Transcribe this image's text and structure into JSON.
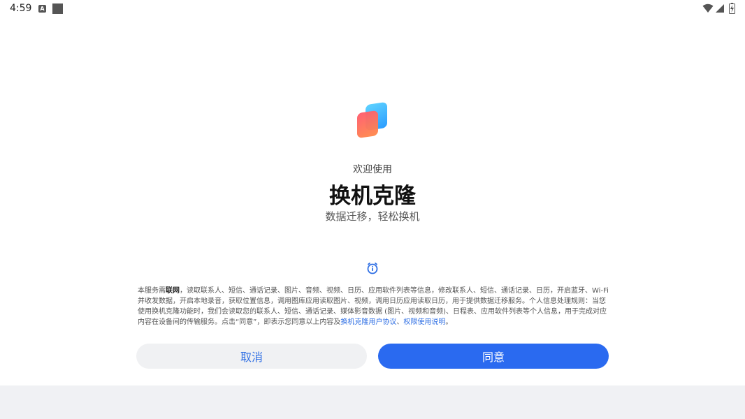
{
  "status_bar": {
    "time": "4:59",
    "a_icon_letter": "A"
  },
  "app": {
    "welcome": "欢迎使用",
    "title": "换机克隆",
    "subtitle": "数据迁移，轻松换机"
  },
  "privacy": {
    "p1": "本服务需",
    "bold": "联网",
    "p2": "，读取联系人、短信、通话记录、图片、音频、视频、日历、应用软件列表等信息，修改联系人、短信、通话记录、日历，开启蓝牙、Wi-Fi 并收发数据，开启本地录音，获取位置信息，调用图库应用读取图片、视频，调用日历应用读取日历，用于提供数据迁移服务。个人信息处理规则：当您使用换机克隆功能时，我们会读取您的联系人、短信、通话记录、媒体影音数据 (图片、视频和音频)、日程表、应用软件列表等个人信息，用于完成对应内容在设备间的传输服务。点击“同意”，即表示您同意以上内容及",
    "link1": "换机克隆用户协议",
    "sep": "、",
    "link2": "权限使用说明",
    "end": "。"
  },
  "buttons": {
    "cancel": "取消",
    "agree": "同意"
  },
  "colors": {
    "accent": "#2a6af0",
    "link": "#2f6fe4"
  }
}
